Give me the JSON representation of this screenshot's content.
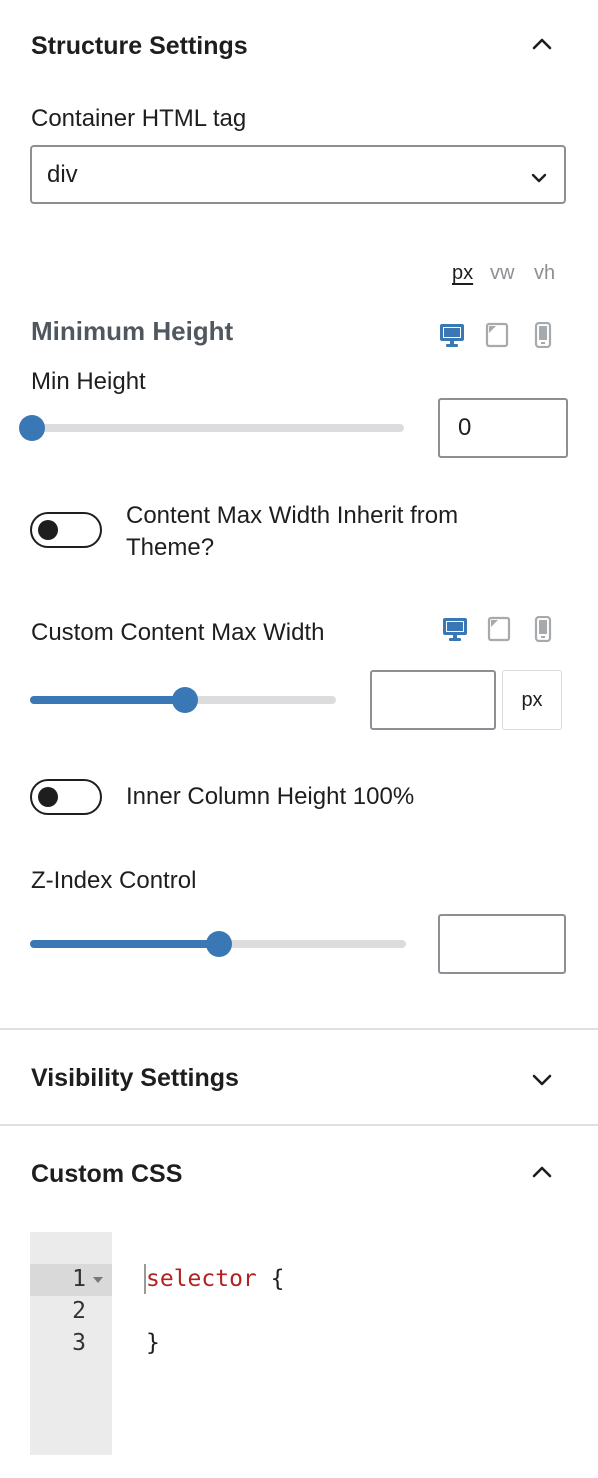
{
  "structure": {
    "title": "Structure Settings",
    "container_tag_label": "Container HTML tag",
    "container_tag_value": "div",
    "units": [
      "px",
      "vw",
      "vh"
    ],
    "active_unit": "px",
    "min_height_section_title": "Minimum Height",
    "min_height_label": "Min Height",
    "min_height_value": "0",
    "min_height_slider_fraction": 0,
    "content_max_width_toggle_label": "Content Max Width Inherit from Theme?",
    "content_max_width_toggle_on": false,
    "custom_max_width_label": "Custom Content Max Width",
    "custom_max_width_value": "",
    "custom_max_width_unit": "px",
    "custom_max_width_slider_fraction": 0.5,
    "inner_column_toggle_label": "Inner Column Height 100%",
    "inner_column_toggle_on": false,
    "z_index_label": "Z-Index Control",
    "z_index_value": "",
    "z_index_slider_fraction": 0.51,
    "device_icons": [
      "desktop-icon",
      "tablet-icon",
      "mobile-icon"
    ],
    "active_device": "desktop-icon"
  },
  "visibility": {
    "title": "Visibility Settings",
    "expanded": false
  },
  "custom_css": {
    "title": "Custom CSS",
    "expanded": true,
    "line_numbers": [
      "1",
      "2",
      "3"
    ],
    "line1_selector": "selector",
    "line1_brace": " {",
    "line2": "",
    "line3": "}"
  },
  "colors": {
    "accent": "#3a78b5",
    "track": "#dcdcde",
    "text": "#1e1e1e",
    "muted": "#8c8f94"
  }
}
